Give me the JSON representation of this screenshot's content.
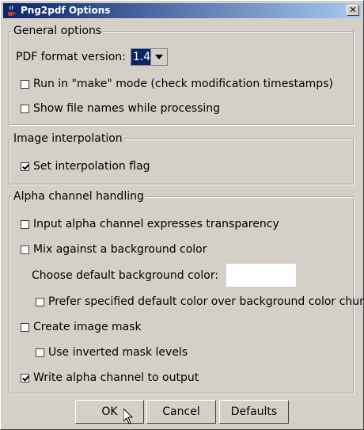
{
  "window": {
    "title": "Png2pdf Options",
    "close_glyph": "✕"
  },
  "general": {
    "legend": "General options",
    "pdf_version_label": "PDF format version:",
    "pdf_version_value": "1.4",
    "make_mode_label": "Run in \"make\" mode (check modification timestamps)",
    "make_mode_checked": false,
    "show_names_label": "Show file names while processing",
    "show_names_checked": false
  },
  "interpolation": {
    "legend": "Image interpolation",
    "set_flag_label": "Set interpolation flag",
    "set_flag_checked": true
  },
  "alpha": {
    "legend": "Alpha channel handling",
    "transparency_label": "Input alpha channel expresses transparency",
    "transparency_checked": false,
    "mix_label": "Mix against a background color",
    "mix_checked": false,
    "bg_color_label": "Choose default background color:",
    "bg_color_value": "#ffffff",
    "prefer_default_label": "Prefer specified default color over background color chunk",
    "prefer_default_checked": false,
    "image_mask_label": "Create image mask",
    "image_mask_checked": false,
    "inverted_mask_label": "Use inverted mask levels",
    "inverted_mask_checked": false,
    "write_alpha_label": "Write alpha channel to output",
    "write_alpha_checked": true
  },
  "buttons": {
    "ok": "OK",
    "cancel": "Cancel",
    "defaults": "Defaults"
  }
}
